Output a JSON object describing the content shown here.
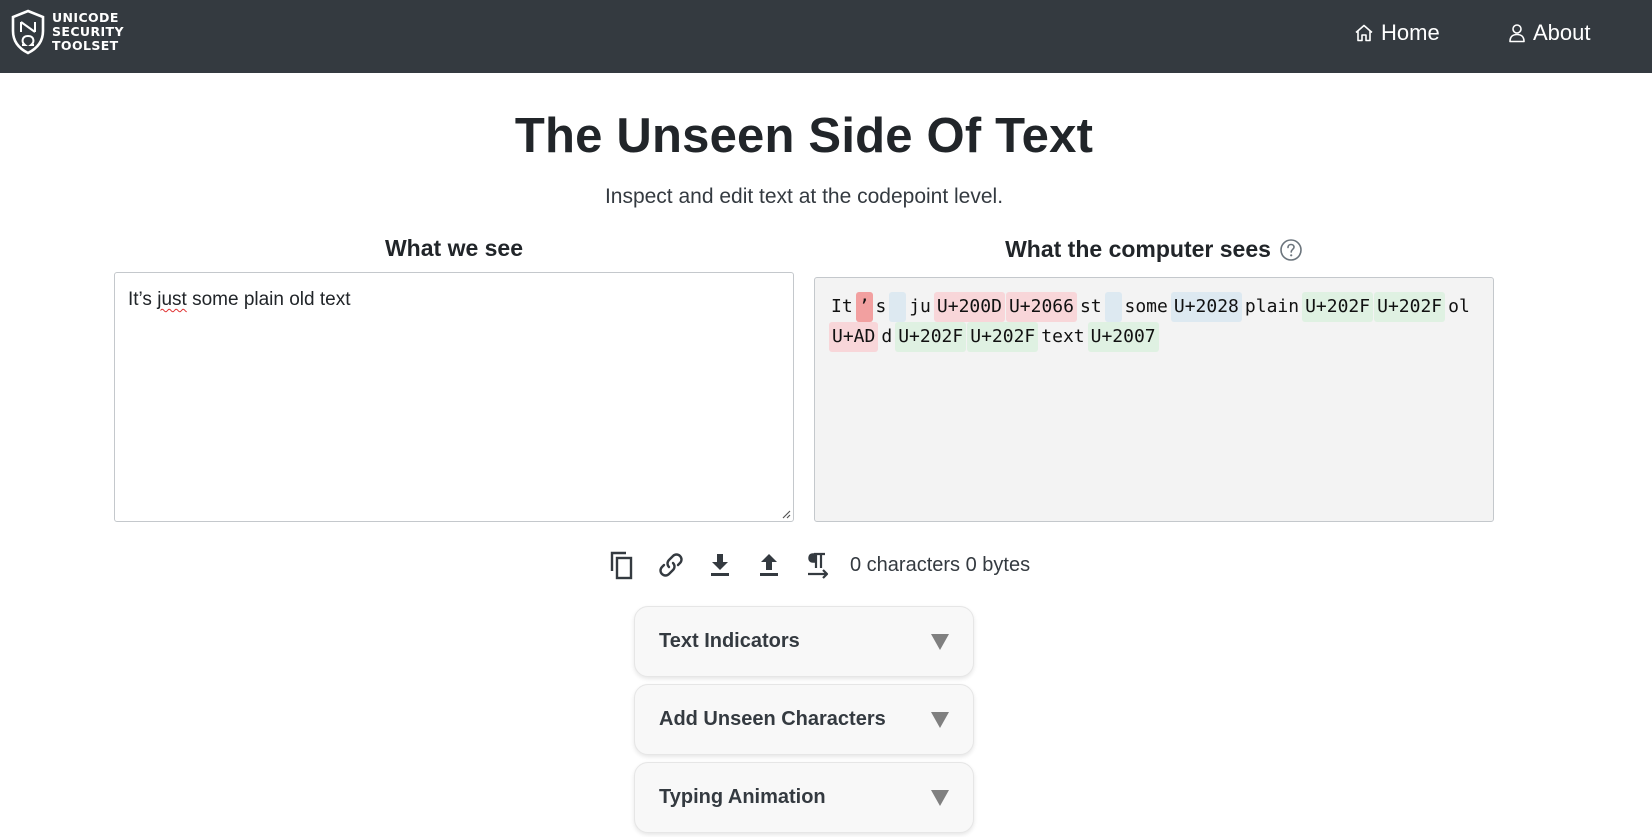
{
  "navbar": {
    "brand_lines": [
      "UNICODE",
      "SECURITY",
      "TOOLSET"
    ],
    "links": [
      {
        "label": "Home",
        "icon": "home-icon"
      },
      {
        "label": "About",
        "icon": "user-icon"
      }
    ]
  },
  "header": {
    "title": "The Unseen Side Of Text",
    "subtitle": "Inspect and edit text at the codepoint level."
  },
  "editor": {
    "heading": "What we see",
    "text_before": "It’s ",
    "text_flagged": "just",
    "text_after": " some plain old text"
  },
  "viewer": {
    "heading": "What the computer sees",
    "help_icon": "question-circle-icon",
    "tokens": [
      {
        "text": "It",
        "kind": "plain"
      },
      {
        "text": "’",
        "kind": "redstrong"
      },
      {
        "text": "s",
        "kind": "plain"
      },
      {
        "text": " ",
        "kind": "blue"
      },
      {
        "text": "ju",
        "kind": "plain"
      },
      {
        "text": "U+200D",
        "kind": "red"
      },
      {
        "text": "U+2066",
        "kind": "red"
      },
      {
        "text": "st",
        "kind": "plain"
      },
      {
        "text": " ",
        "kind": "blue"
      },
      {
        "text": "some",
        "kind": "plain"
      },
      {
        "text": "U+2028",
        "kind": "blue"
      },
      {
        "text": "plain",
        "kind": "plain"
      },
      {
        "text": "U+202F",
        "kind": "green"
      },
      {
        "text": "U+202F",
        "kind": "green"
      },
      {
        "text": "ol",
        "kind": "plain"
      },
      {
        "text": "U+AD",
        "kind": "red"
      },
      {
        "text": "d",
        "kind": "plain"
      },
      {
        "text": "U+202F",
        "kind": "green"
      },
      {
        "text": "U+202F",
        "kind": "green"
      },
      {
        "text": "text",
        "kind": "plain"
      },
      {
        "text": "U+2007",
        "kind": "green"
      }
    ]
  },
  "toolbar": {
    "buttons": [
      "copy-icon",
      "link-icon",
      "download-icon",
      "upload-icon",
      "text-direction-icon"
    ],
    "stats": "0 characters 0 bytes"
  },
  "accordions": [
    {
      "label": "Text Indicators"
    },
    {
      "label": "Add Unseen Characters"
    },
    {
      "label": "Typing Animation"
    }
  ],
  "colors": {
    "navbar": "#343a40",
    "token_red": "#f8d6d9",
    "token_red_strong": "#f2a0a0",
    "token_green": "#dff1e2",
    "token_blue": "#dde9f1"
  }
}
